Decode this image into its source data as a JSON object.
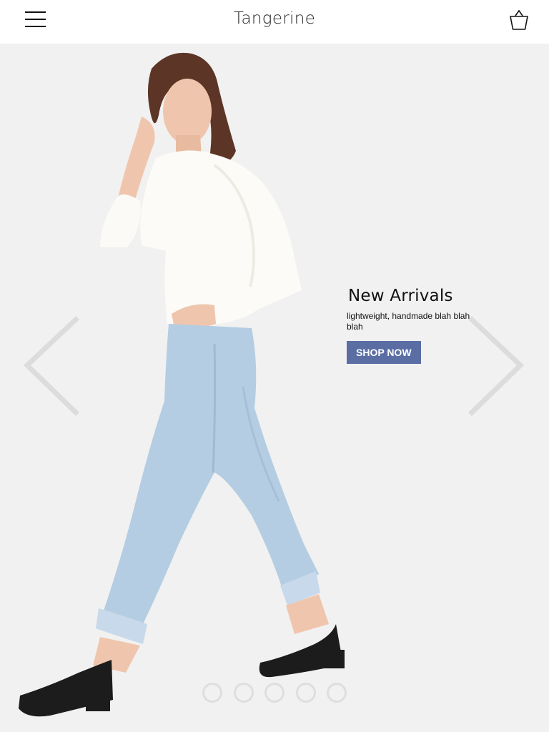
{
  "header": {
    "brand": "Tangerine",
    "menu_icon": "hamburger-menu-icon",
    "cart_icon": "shopping-bag-icon"
  },
  "hero": {
    "title": "New Arrivals",
    "subtitle": "lightweight, handmade blah blah blah",
    "cta_label": "SHOP NOW",
    "prev_icon": "chevron-left-icon",
    "next_icon": "chevron-right-icon",
    "slide_count": 5
  },
  "colors": {
    "header_bg": "#ffffff",
    "hero_bg": "#f1f1f1",
    "button": "#5a6ea4",
    "dot": "#dedede",
    "arrow": "#dcdcdc"
  }
}
